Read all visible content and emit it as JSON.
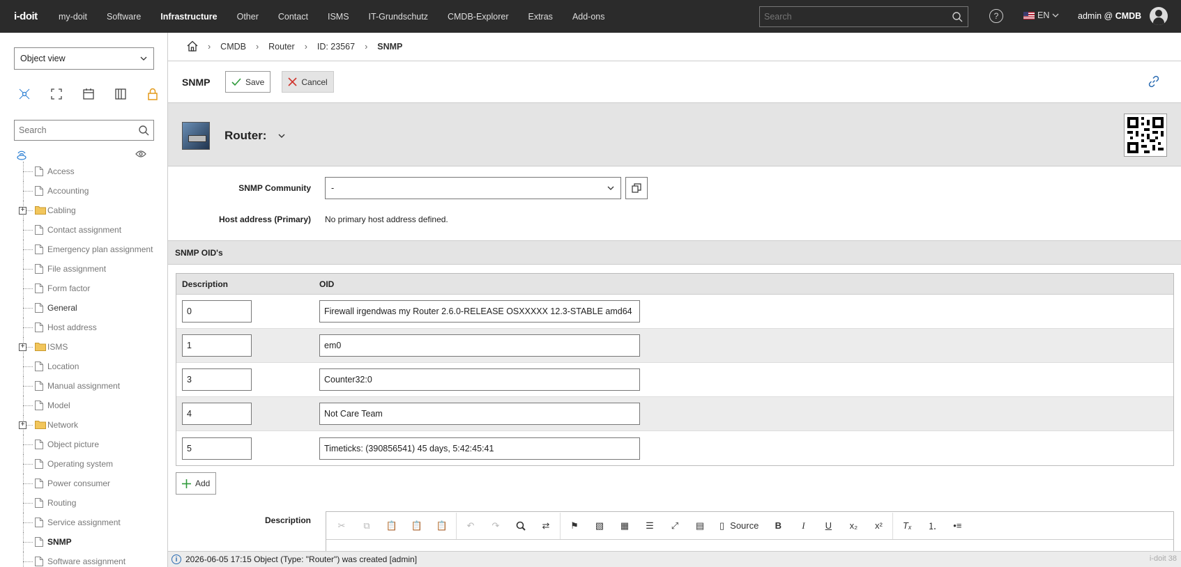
{
  "topnav": {
    "logo": "i-doit",
    "items": [
      "my-doit",
      "Software",
      "Infrastructure",
      "Other",
      "Contact",
      "ISMS",
      "IT-Grundschutz",
      "CMDB-Explorer",
      "Extras",
      "Add-ons"
    ],
    "active": "Infrastructure",
    "search_placeholder": "Search",
    "language": "EN",
    "user": "admin @",
    "tenant": "CMDB"
  },
  "sidebar": {
    "view_select": "Object view",
    "search_placeholder": "Search",
    "tree": [
      {
        "label": "Access",
        "type": "file"
      },
      {
        "label": "Accounting",
        "type": "file"
      },
      {
        "label": "Cabling",
        "type": "folder"
      },
      {
        "label": "Contact assignment",
        "type": "file"
      },
      {
        "label": "Emergency plan assignment",
        "type": "file"
      },
      {
        "label": "File assignment",
        "type": "file"
      },
      {
        "label": "Form factor",
        "type": "file"
      },
      {
        "label": "General",
        "type": "file",
        "dark": true
      },
      {
        "label": "Host address",
        "type": "file"
      },
      {
        "label": "ISMS",
        "type": "folder"
      },
      {
        "label": "Location",
        "type": "file"
      },
      {
        "label": "Manual assignment",
        "type": "file"
      },
      {
        "label": "Model",
        "type": "file"
      },
      {
        "label": "Network",
        "type": "folder"
      },
      {
        "label": "Object picture",
        "type": "file"
      },
      {
        "label": "Operating system",
        "type": "file"
      },
      {
        "label": "Power consumer",
        "type": "file"
      },
      {
        "label": "Routing",
        "type": "file"
      },
      {
        "label": "Service assignment",
        "type": "file"
      },
      {
        "label": "SNMP",
        "type": "file",
        "bold": true
      },
      {
        "label": "Software assignment",
        "type": "file"
      }
    ]
  },
  "breadcrumb": [
    "CMDB",
    "Router",
    "ID: 23567",
    "SNMP"
  ],
  "header": {
    "title": "SNMP",
    "save_label": "Save",
    "cancel_label": "Cancel"
  },
  "object": {
    "title": "Router:"
  },
  "form": {
    "snmp_community_label": "SNMP Community",
    "snmp_community_value": "-",
    "host_address_label": "Host address (Primary)",
    "host_address_value": "No primary host address defined."
  },
  "oids": {
    "section_title": "SNMP OID's",
    "col_description": "Description",
    "col_oid": "OID",
    "rows": [
      {
        "description": "0",
        "oid": "Firewall irgendwas my Router 2.6.0-RELEASE OSXXXXX 12.3-STABLE amd64"
      },
      {
        "description": "1",
        "oid": "em0"
      },
      {
        "description": "3",
        "oid": "Counter32:0"
      },
      {
        "description": "4",
        "oid": "Not Care Team"
      },
      {
        "description": "5",
        "oid": "Timeticks: (390856541) 45 days, 5:42:45:41"
      }
    ],
    "add_label": "Add"
  },
  "description": {
    "label": "Description",
    "source_label": "Source"
  },
  "status": {
    "message": "2026-06-05 17:15 Object (Type: \"Router\") was created [admin]",
    "version": "i-doit 38"
  }
}
